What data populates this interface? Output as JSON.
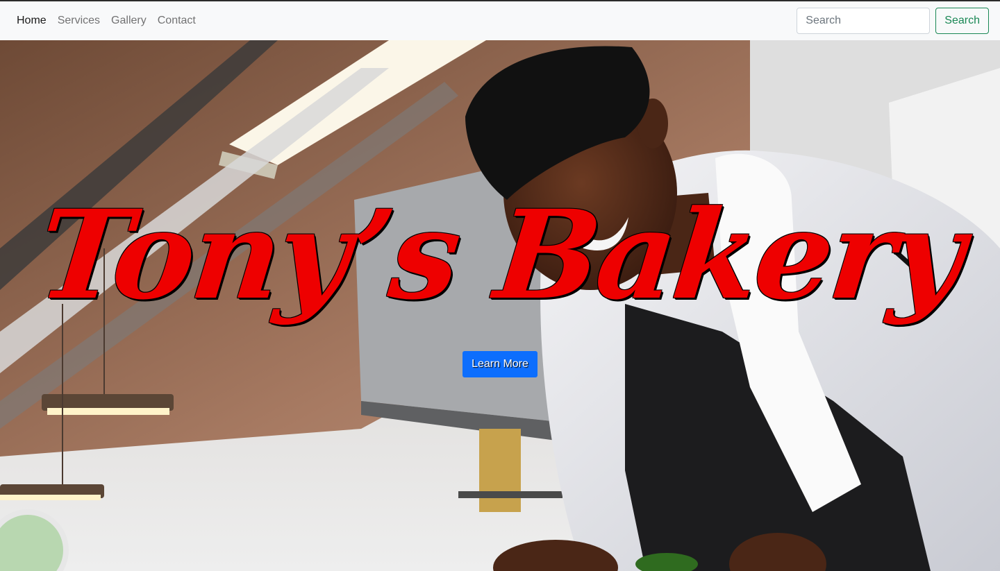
{
  "nav": {
    "links": [
      "Home",
      "Services",
      "Gallery",
      "Contact"
    ],
    "active": "Home"
  },
  "search": {
    "placeholder": "Search",
    "button_label": "Search"
  },
  "hero": {
    "title": "Tony’s Bakery",
    "button_label": "Learn More",
    "title_color": "#ee0000",
    "button_color": "#0d6efd"
  },
  "colors": {
    "navbar_bg": "#f8f9fa",
    "search_button": "#198754"
  }
}
